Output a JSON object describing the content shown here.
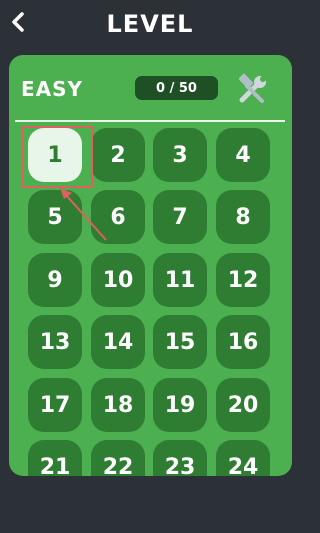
{
  "header": {
    "title": "LEVEL",
    "back_icon": "chevron-left-icon"
  },
  "panel": {
    "difficulty": "EASY",
    "progress": "0 / 50",
    "tools_icon": "hammer-wrench-icon"
  },
  "levels": [
    "1",
    "2",
    "3",
    "4",
    "5",
    "6",
    "7",
    "8",
    "9",
    "10",
    "11",
    "12",
    "13",
    "14",
    "15",
    "16",
    "17",
    "18",
    "19",
    "20",
    "21",
    "22",
    "23",
    "24"
  ],
  "selected_level": "1",
  "colors": {
    "background": "#2b3136",
    "panel": "#4caf50",
    "tile": "#2e7d32",
    "selected_tile": "#e8f5e9",
    "progress_pill": "#1e4f25",
    "annotation": "#e06060"
  }
}
